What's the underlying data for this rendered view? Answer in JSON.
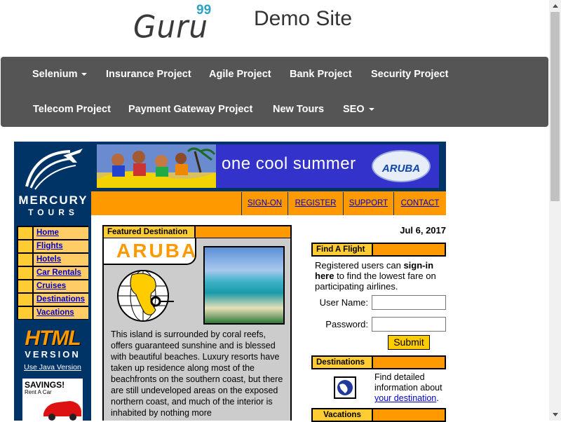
{
  "header": {
    "logo_text": "Guru",
    "logo_sup": "99",
    "site_title": "Demo Site"
  },
  "navbar": {
    "items": [
      {
        "label": "Selenium",
        "dropdown": true
      },
      {
        "label": "Insurance Project"
      },
      {
        "label": "Agile Project"
      },
      {
        "label": "Bank Project"
      },
      {
        "label": "Security Project"
      },
      {
        "label": "Telecom Project"
      },
      {
        "label": "Payment Gateway Project"
      },
      {
        "label": "New Tours"
      },
      {
        "label": "SEO",
        "dropdown": true
      }
    ],
    "bg_color": "#555555"
  },
  "mercury": {
    "logo_line1": "MERCURY",
    "logo_line2": "TOURS",
    "side_menu": [
      "Home",
      "Flights",
      "Hotels",
      "Car Rentals",
      "Cruises",
      "Destinations",
      "Vacations"
    ],
    "html_version_line1": "HTML",
    "html_version_line2": "VERSION",
    "java_link": "Use Java Version",
    "ad_title": "SAVINGS!",
    "ad_sub": "Rent A Car",
    "banner_text": "one cool summer",
    "banner_logo": "ARUBA",
    "top_nav": [
      "SIGN-ON",
      "REGISTER",
      "SUPPORT",
      "CONTACT"
    ],
    "frame_color": "#003366",
    "accent_color": "#ff9900"
  },
  "featured": {
    "header": "Featured Destination",
    "title": "ARUBA",
    "description": "This island is surrounded by coral reefs, offers guaranteed sunshine and is blessed with beautiful beaches. Luxury resorts have taken up residence along most of the beachfronts on the southern coast, but there are still undeveloped areas on the exposed northern coast, and much of the interior is inhabited by nothing more"
  },
  "right": {
    "date": "Jul 6, 2017",
    "find_flight": {
      "header": "Find A Flight",
      "text_before": "Registered users can ",
      "text_bold": "sign-in here",
      "text_after": " to find the lowest fare on participating airlines.",
      "username_label": "User Name:",
      "username_value": "",
      "password_label": "Password:",
      "password_value": "",
      "submit_label": "Submit"
    },
    "destinations": {
      "header": "Destinations",
      "text": "Find detailed information about ",
      "link": "your destination",
      "suffix": "."
    },
    "vacations": {
      "header": "Vacations"
    }
  }
}
